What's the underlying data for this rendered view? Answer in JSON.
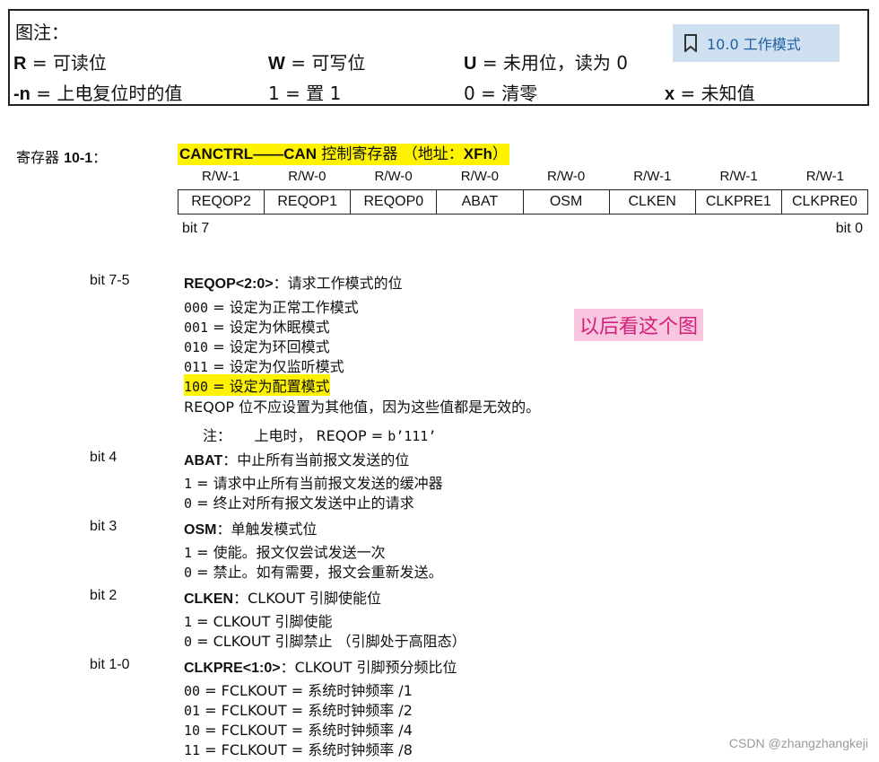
{
  "legend": {
    "title": "图注：",
    "items": [
      {
        "key": "R",
        "text": "= 可读位"
      },
      {
        "key": "W",
        "text": "= 可写位"
      },
      {
        "key": "U",
        "text": "= 未用位，读为 0"
      },
      {
        "key": "-n",
        "text": "= 上电复位时的值"
      },
      {
        "key": "1",
        "text": "= 置 1"
      },
      {
        "key": "0",
        "text": "= 清零"
      },
      {
        "key": "x",
        "text": "= 未知值"
      }
    ]
  },
  "bookmark": {
    "label": "10.0 工作模式"
  },
  "register": {
    "label_prefix": "寄存器 ",
    "label_num": "10-1",
    "label_suffix": "：",
    "title_name": "CANCTRL——CAN",
    "title_rest": " 控制寄存器 （地址：",
    "title_addr": "XFh",
    "title_end": "）",
    "access": [
      "R/W-1",
      "R/W-0",
      "R/W-0",
      "R/W-0",
      "R/W-0",
      "R/W-1",
      "R/W-1",
      "R/W-1"
    ],
    "bits": [
      "REQOP2",
      "REQOP1",
      "REQOP0",
      "ABAT",
      "OSM",
      "CLKEN",
      "CLKPRE1",
      "CLKPRE0"
    ],
    "bit_high": "bit 7",
    "bit_low": "bit 0"
  },
  "descriptions": {
    "b75": {
      "label": "bit 7-5",
      "name": "REQOP<2:0>",
      "desc": "：请求工作模式的位",
      "opts": [
        {
          "code": "000",
          "text": "= 设定为正常工作模式"
        },
        {
          "code": "001",
          "text": "= 设定为休眠模式"
        },
        {
          "code": "010",
          "text": "= 设定为环回模式"
        },
        {
          "code": "011",
          "text": "= 设定为仅监听模式"
        },
        {
          "code": "100",
          "text": "= 设定为配置模式"
        }
      ],
      "extra": "REQOP 位不应设置为其他值，因为这些值都是无效的。",
      "note_label": "注：",
      "note_text": "上电时， REQOP = ",
      "note_code": "b’111’"
    },
    "b4": {
      "label": "bit 4",
      "name": "ABAT",
      "desc": "：中止所有当前报文发送的位",
      "opts": [
        {
          "code": "1",
          "text": "= 请求中止所有当前报文发送的缓冲器"
        },
        {
          "code": "0",
          "text": "= 终止对所有报文发送中止的请求"
        }
      ]
    },
    "b3": {
      "label": "bit 3",
      "name": "OSM",
      "desc": "：单触发模式位",
      "opts": [
        {
          "code": "1",
          "text": "= 使能。报文仅尝试发送一次"
        },
        {
          "code": "0",
          "text": "= 禁止。如有需要，报文会重新发送。"
        }
      ]
    },
    "b2": {
      "label": "bit 2",
      "name": "CLKEN",
      "desc": "：CLKOUT 引脚使能位",
      "opts": [
        {
          "code": "1",
          "text": "= CLKOUT 引脚使能"
        },
        {
          "code": "0",
          "text": "= CLKOUT 引脚禁止 （引脚处于高阻态）"
        }
      ]
    },
    "b10": {
      "label": "bit 1-0",
      "name": "CLKPRE<1:0>",
      "desc": "：CLKOUT 引脚预分频比位",
      "opts": [
        {
          "code": "00",
          "text": "= FCLKOUT = 系统时钟频率 /1"
        },
        {
          "code": "01",
          "text": "= FCLKOUT = 系统时钟频率 /2"
        },
        {
          "code": "10",
          "text": "= FCLKOUT = 系统时钟频率 /4"
        },
        {
          "code": "11",
          "text": "= FCLKOUT = 系统时钟频率 /8"
        }
      ]
    }
  },
  "annotation": "以后看这个图",
  "watermark": "CSDN @zhangzhangkeji"
}
